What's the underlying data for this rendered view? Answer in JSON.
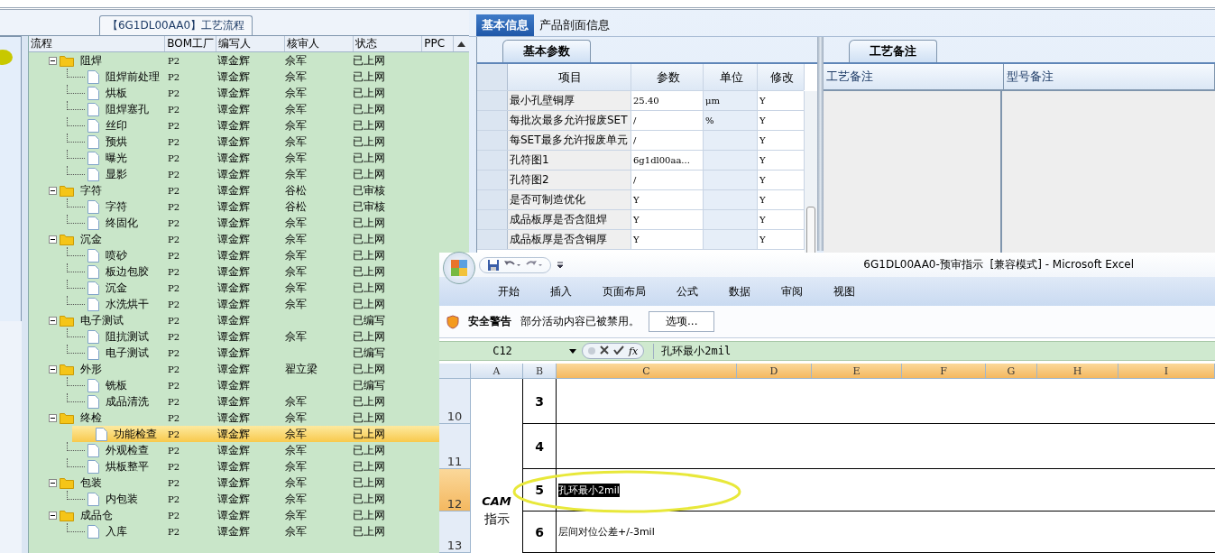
{
  "tree_panel": {
    "title": "【6G1DL00AA0】工艺流程",
    "columns": [
      "流程",
      "BOM工厂",
      "编写人",
      "核审人",
      "状态",
      "PPC"
    ],
    "nodes": [
      {
        "name": "阻焊",
        "bom": "P2",
        "author": "谭金辉",
        "reviewer": "佘军",
        "status": "已上网",
        "expanded": true,
        "selected": false,
        "children": [
          {
            "name": "阻焊前处理",
            "bom": "P2",
            "author": "谭金辉",
            "reviewer": "佘军",
            "status": "已上网",
            "selected": false
          },
          {
            "name": "烘板",
            "bom": "P2",
            "author": "谭金辉",
            "reviewer": "佘军",
            "status": "已上网",
            "selected": false
          },
          {
            "name": "阻焊塞孔",
            "bom": "P2",
            "author": "谭金辉",
            "reviewer": "佘军",
            "status": "已上网",
            "selected": false
          },
          {
            "name": "丝印",
            "bom": "P2",
            "author": "谭金辉",
            "reviewer": "佘军",
            "status": "已上网",
            "selected": false
          },
          {
            "name": "预烘",
            "bom": "P2",
            "author": "谭金辉",
            "reviewer": "佘军",
            "status": "已上网",
            "selected": false
          },
          {
            "name": "曝光",
            "bom": "P2",
            "author": "谭金辉",
            "reviewer": "佘军",
            "status": "已上网",
            "selected": false
          },
          {
            "name": "显影",
            "bom": "P2",
            "author": "谭金辉",
            "reviewer": "佘军",
            "status": "已上网",
            "selected": false
          }
        ]
      },
      {
        "name": "字符",
        "bom": "P2",
        "author": "谭金辉",
        "reviewer": "谷松",
        "status": "已审核",
        "expanded": true,
        "selected": false,
        "children": [
          {
            "name": "字符",
            "bom": "P2",
            "author": "谭金辉",
            "reviewer": "谷松",
            "status": "已审核",
            "selected": false
          },
          {
            "name": "终固化",
            "bom": "P2",
            "author": "谭金辉",
            "reviewer": "佘军",
            "status": "已上网",
            "selected": false
          }
        ]
      },
      {
        "name": "沉金",
        "bom": "P2",
        "author": "谭金辉",
        "reviewer": "佘军",
        "status": "已上网",
        "expanded": true,
        "selected": false,
        "children": [
          {
            "name": "喷砂",
            "bom": "P2",
            "author": "谭金辉",
            "reviewer": "佘军",
            "status": "已上网",
            "selected": false
          },
          {
            "name": "板边包胶",
            "bom": "P2",
            "author": "谭金辉",
            "reviewer": "佘军",
            "status": "已上网",
            "selected": false
          },
          {
            "name": "沉金",
            "bom": "P2",
            "author": "谭金辉",
            "reviewer": "佘军",
            "status": "已上网",
            "selected": false
          },
          {
            "name": "水洗烘干",
            "bom": "P2",
            "author": "谭金辉",
            "reviewer": "佘军",
            "status": "已上网",
            "selected": false
          }
        ]
      },
      {
        "name": "电子测试",
        "bom": "P2",
        "author": "谭金辉",
        "status": "已编写",
        "expanded": true,
        "selected": false,
        "children": [
          {
            "name": "阻抗测试",
            "bom": "P2",
            "author": "谭金辉",
            "reviewer": "佘军",
            "status": "已上网",
            "selected": false
          },
          {
            "name": "电子测试",
            "bom": "P2",
            "author": "谭金辉",
            "status": "已编写",
            "selected": false
          }
        ]
      },
      {
        "name": "外形",
        "bom": "P2",
        "author": "谭金辉",
        "reviewer": "翟立梁",
        "status": "已上网",
        "expanded": true,
        "selected": false,
        "children": [
          {
            "name": "铣板",
            "bom": "P2",
            "author": "谭金辉",
            "status": "已编写",
            "selected": false
          },
          {
            "name": "成品清洗",
            "bom": "P2",
            "author": "谭金辉",
            "reviewer": "佘军",
            "status": "已上网",
            "selected": false
          }
        ]
      },
      {
        "name": "终检",
        "bom": "P2",
        "author": "谭金辉",
        "reviewer": "佘军",
        "status": "已上网",
        "expanded": true,
        "selected": false,
        "children": [
          {
            "name": "功能检查",
            "bom": "P2",
            "author": "谭金辉",
            "reviewer": "佘军",
            "status": "已上网",
            "selected": true
          },
          {
            "name": "外观检查",
            "bom": "P2",
            "author": "谭金辉",
            "reviewer": "佘军",
            "status": "已上网",
            "selected": false
          },
          {
            "name": "烘板整平",
            "bom": "P2",
            "author": "谭金辉",
            "reviewer": "佘军",
            "status": "已上网",
            "selected": false
          }
        ]
      },
      {
        "name": "包装",
        "bom": "P2",
        "author": "谭金辉",
        "reviewer": "佘军",
        "status": "已上网",
        "expanded": true,
        "selected": false,
        "children": [
          {
            "name": "内包装",
            "bom": "P2",
            "author": "谭金辉",
            "reviewer": "佘军",
            "status": "已上网",
            "selected": false
          }
        ]
      },
      {
        "name": "成品仓",
        "bom": "P2",
        "author": "谭金辉",
        "reviewer": "佘军",
        "status": "已上网",
        "expanded": true,
        "selected": false,
        "children": [
          {
            "name": "入库",
            "bom": "P2",
            "author": "谭金辉",
            "reviewer": "佘军",
            "status": "已上网",
            "selected": false
          }
        ]
      }
    ]
  },
  "info_panel": {
    "tabs": [
      {
        "label": "基本信息",
        "selected": true
      },
      {
        "label": "产品剖面信息",
        "selected": false
      }
    ],
    "params": {
      "tab": "基本参数",
      "columns": [
        "项目",
        "参数",
        "单位",
        "修改"
      ],
      "rows": [
        {
          "item": "最小孔壁铜厚",
          "value": "25.40",
          "unit": "μm",
          "edit": "Y"
        },
        {
          "item": "每批次最多允许报废SET",
          "value": "/",
          "unit": "%",
          "edit": "Y"
        },
        {
          "item": "每SET最多允许报废单元",
          "value": "/",
          "edit": "Y"
        },
        {
          "item": "孔符图1",
          "value": "6g1dl00aa...",
          "edit": "Y"
        },
        {
          "item": "孔符图2",
          "value": "/",
          "edit": "Y"
        },
        {
          "item": "是否可制造优化",
          "value": "Y",
          "edit": "Y"
        },
        {
          "item": "成品板厚是否含阻焊",
          "value": "Y",
          "edit": "Y"
        },
        {
          "item": "成品板厚是否含铜厚",
          "value": "Y",
          "edit": "Y"
        }
      ]
    },
    "notes": {
      "tab": "工艺备注",
      "columns": [
        "工艺备注",
        "型号备注"
      ]
    }
  },
  "excel": {
    "title": "6G1DL00AA0-预审指示  [兼容模式] - Microsoft Excel",
    "ribbon_tabs": [
      "开始",
      "插入",
      "页面布局",
      "公式",
      "数据",
      "审阅",
      "视图"
    ],
    "security": {
      "label": "安全警告",
      "message": "部分活动内容已被禁用。",
      "button": "选项..."
    },
    "name_box": "C12",
    "function_label": "fx",
    "formula": "孔环最小2mil",
    "columns": [
      {
        "label": "A",
        "selected": false
      },
      {
        "label": "B",
        "selected": false
      },
      {
        "label": "C",
        "selected": true
      },
      {
        "label": "D",
        "selected": true
      },
      {
        "label": "E",
        "selected": true
      },
      {
        "label": "F",
        "selected": true
      },
      {
        "label": "G",
        "selected": true
      },
      {
        "label": "H",
        "selected": true
      },
      {
        "label": "I",
        "selected": true
      }
    ],
    "cam_cell": [
      "CAM",
      "指示"
    ],
    "rows": [
      {
        "number": "10",
        "selected": false,
        "index": "3"
      },
      {
        "number": "11",
        "selected": false,
        "index": "4"
      },
      {
        "number": "12",
        "selected": true,
        "index": "5",
        "text": "孔环最小2mil",
        "text_selected": true
      },
      {
        "number": "13",
        "selected": false,
        "index": "6",
        "text": "层间对位公差+/-3mil",
        "text_selected": false
      }
    ]
  }
}
